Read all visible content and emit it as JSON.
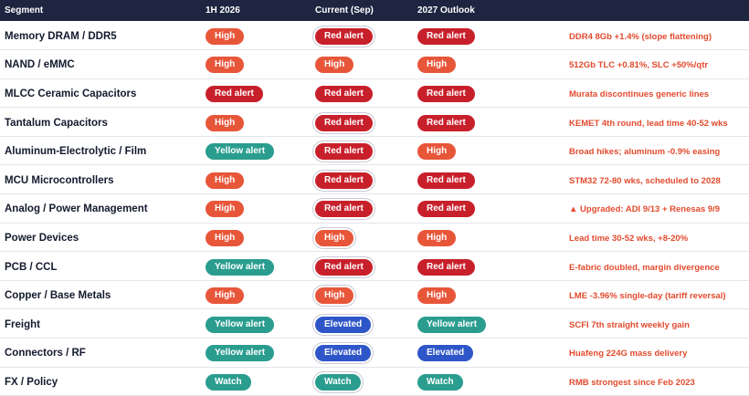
{
  "header": {
    "segment": "Segment",
    "h1_2026": "1H 2026",
    "current": "Current (Sep)",
    "outlook": "2027 Outlook",
    "notes": ""
  },
  "status_colors": {
    "High": "#e8563a",
    "Red alert": "#c8202b",
    "Yellow alert": "#2a9d8f",
    "Elevated": "#2f56c9",
    "Watch": "#2a9d8f"
  },
  "rows": [
    {
      "segment": "Memory DRAM / DDR5",
      "h1": "High",
      "current": "Red alert",
      "current_ring": true,
      "outlook": "Red alert",
      "note": "DDR4 8Gb +1.4% (slope flattening)"
    },
    {
      "segment": "NAND / eMMC",
      "h1": "High",
      "current": "High",
      "current_ring": false,
      "outlook": "High",
      "note": "512Gb TLC +0.81%, SLC +50%/qtr"
    },
    {
      "segment": "MLCC Ceramic Capacitors",
      "h1": "Red alert",
      "current": "Red alert",
      "current_ring": false,
      "outlook": "Red alert",
      "note": "Murata discontinues generic lines"
    },
    {
      "segment": "Tantalum Capacitors",
      "h1": "High",
      "current": "Red alert",
      "current_ring": true,
      "outlook": "Red alert",
      "note": "KEMET 4th round, lead time 40-52 wks"
    },
    {
      "segment": "Aluminum-Electrolytic / Film",
      "h1": "Yellow alert",
      "current": "Red alert",
      "current_ring": true,
      "outlook": "High",
      "note": "Broad hikes; aluminum -0.9% easing"
    },
    {
      "segment": "MCU Microcontrollers",
      "h1": "High",
      "current": "Red alert",
      "current_ring": true,
      "outlook": "Red alert",
      "note": "STM32 72-80 wks, scheduled to 2028"
    },
    {
      "segment": "Analog / Power Management",
      "h1": "High",
      "current": "Red alert",
      "current_ring": true,
      "outlook": "Red alert",
      "note": "▲ Upgraded: ADI 9/13 + Renesas 9/9"
    },
    {
      "segment": "Power Devices",
      "h1": "High",
      "current": "High",
      "current_ring": true,
      "outlook": "High",
      "note": "Lead time 30-52 wks, +8-20%"
    },
    {
      "segment": "PCB / CCL",
      "h1": "Yellow alert",
      "current": "Red alert",
      "current_ring": true,
      "outlook": "Red alert",
      "note": "E-fabric doubled, margin divergence"
    },
    {
      "segment": "Copper / Base Metals",
      "h1": "High",
      "current": "High",
      "current_ring": true,
      "outlook": "High",
      "note": "LME -3.96% single-day (tariff reversal)"
    },
    {
      "segment": "Freight",
      "h1": "Yellow alert",
      "current": "Elevated",
      "current_ring": true,
      "outlook": "Yellow alert",
      "note": "SCFI 7th straight weekly gain"
    },
    {
      "segment": "Connectors / RF",
      "h1": "Yellow alert",
      "current": "Elevated",
      "current_ring": true,
      "outlook": "Elevated",
      "note": "Huafeng 224G mass delivery"
    },
    {
      "segment": "FX / Policy",
      "h1": "Watch",
      "current": "Watch",
      "current_ring": true,
      "outlook": "Watch",
      "note": "RMB strongest since Feb 2023"
    }
  ]
}
